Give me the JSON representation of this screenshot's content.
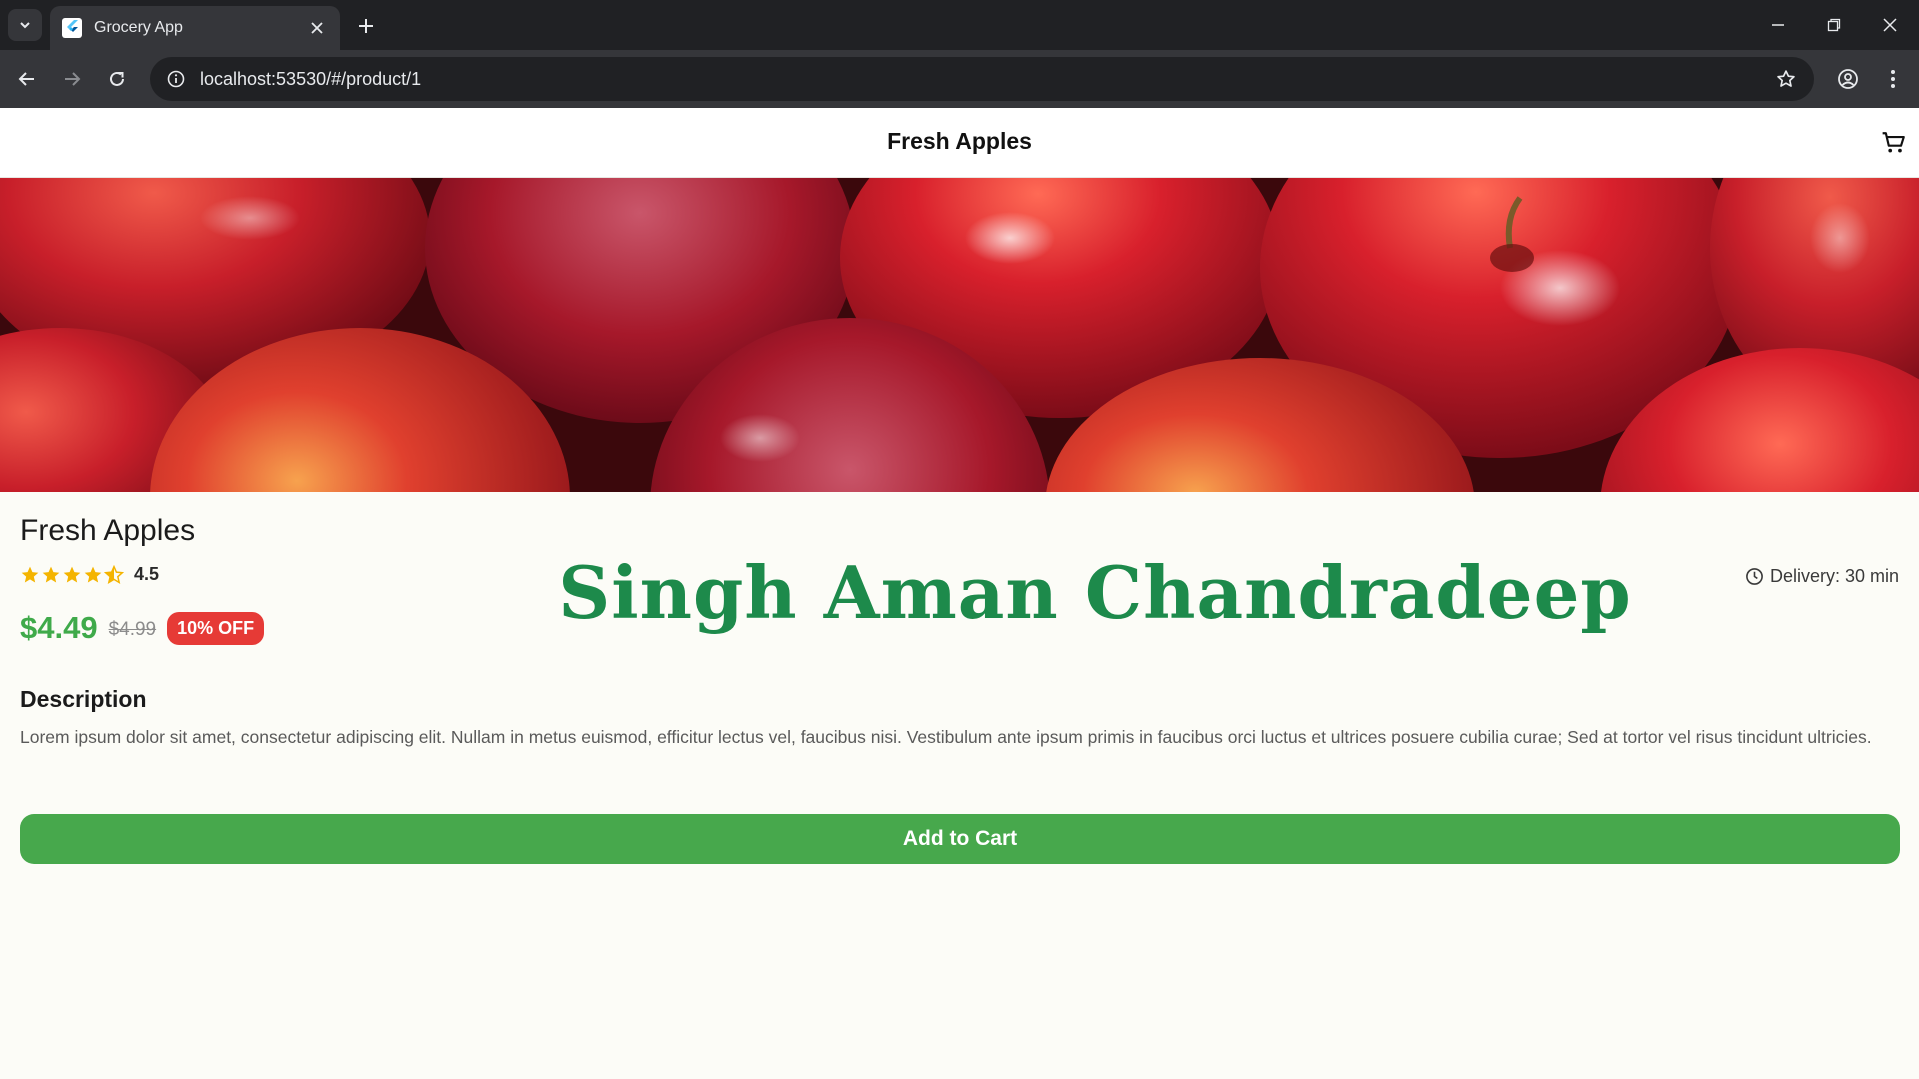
{
  "browser": {
    "tab_title": "Grocery App",
    "url": "localhost:53530/#/product/1"
  },
  "appbar": {
    "title": "Fresh Apples",
    "cart_icon": "shopping-cart-icon"
  },
  "product": {
    "name": "Fresh Apples",
    "rating": "4.5",
    "stars_filled": 4.5,
    "stars_total": 5,
    "price": "$4.49",
    "old_price": "$4.99",
    "discount": "10% OFF",
    "delivery": "Delivery: 30 min",
    "brand_overlay": "Singh Aman Chandradeep",
    "description_heading": "Description",
    "description": "Lorem ipsum dolor sit amet, consectetur adipiscing elit. Nullam in metus euismod, efficitur lectus vel, faucibus nisi. Vestibulum ante ipsum primis in faucibus orci luctus et ultrices posuere cubilia curae; Sed at tortor vel risus tincidunt ultricies.",
    "add_to_cart": "Add to Cart"
  },
  "colors": {
    "accent_green": "#47a84c",
    "price_green": "#3faa4a",
    "brand_green": "#1d8a4b",
    "discount_red": "#e63a36",
    "star_yellow": "#f4b400"
  }
}
